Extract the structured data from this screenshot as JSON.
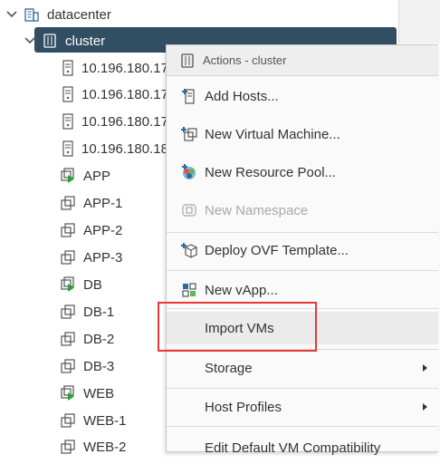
{
  "tree": {
    "root": {
      "label": "datacenter",
      "icon": "datacenter-icon"
    },
    "cluster": {
      "label": "cluster",
      "icon": "cluster-icon"
    },
    "hosts": [
      {
        "label": "10.196.180.17"
      },
      {
        "label": "10.196.180.17"
      },
      {
        "label": "10.196.180.17"
      },
      {
        "label": "10.196.180.18"
      }
    ],
    "vms": [
      {
        "label": "APP",
        "powered_on": true
      },
      {
        "label": "APP-1",
        "powered_on": false
      },
      {
        "label": "APP-2",
        "powered_on": false
      },
      {
        "label": "APP-3",
        "powered_on": false
      },
      {
        "label": "DB",
        "powered_on": true
      },
      {
        "label": "DB-1",
        "powered_on": false
      },
      {
        "label": "DB-2",
        "powered_on": false
      },
      {
        "label": "DB-3",
        "powered_on": false
      },
      {
        "label": "WEB",
        "powered_on": true
      },
      {
        "label": "WEB-1",
        "powered_on": false
      },
      {
        "label": "WEB-2",
        "powered_on": false
      }
    ]
  },
  "menu": {
    "header": "Actions - cluster",
    "items": [
      {
        "label": "Add Hosts...",
        "icon": "add-host-icon",
        "disabled": false
      },
      {
        "label": "New Virtual Machine...",
        "icon": "new-vm-icon",
        "disabled": false
      },
      {
        "label": "New Resource Pool...",
        "icon": "resource-pool-icon",
        "disabled": false
      },
      {
        "label": "New Namespace",
        "icon": "namespace-icon",
        "disabled": true
      },
      {
        "label": "Deploy OVF Template...",
        "icon": "deploy-ovf-icon",
        "disabled": false
      },
      {
        "label": "New vApp...",
        "icon": "vapp-icon",
        "disabled": false
      },
      {
        "label": "Import VMs",
        "icon": "",
        "disabled": false
      },
      {
        "label": "Storage",
        "icon": "",
        "disabled": false,
        "submenu": true
      },
      {
        "label": "Host Profiles",
        "icon": "",
        "disabled": false,
        "submenu": true
      },
      {
        "label": "Edit Default VM Compatibility",
        "icon": "",
        "disabled": false
      }
    ]
  },
  "colors": {
    "selection": "#314e62",
    "highlight_box": "#e53935",
    "icon_blue": "#2b6a9e",
    "power_green": "#2e9e3e",
    "disabled_text": "#a8a8a8"
  }
}
